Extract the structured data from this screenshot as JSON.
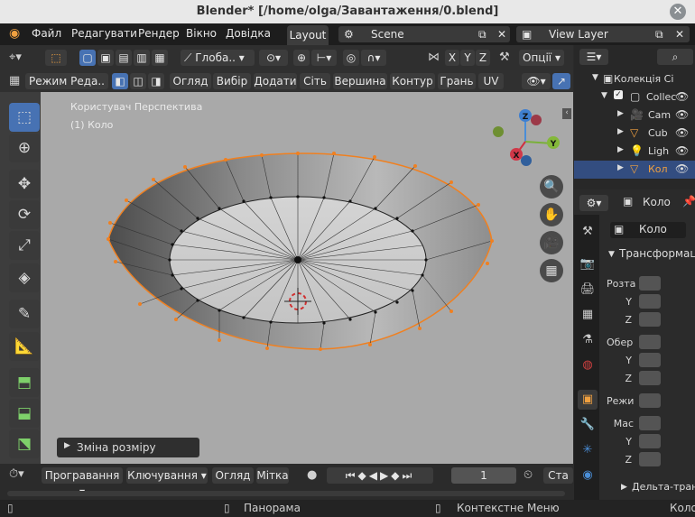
{
  "window": {
    "title": "Blender* [/home/olga/Завантаження/0.blend]"
  },
  "menu": {
    "items": [
      "Файл",
      "Редагувати",
      "Рендер",
      "Вікно",
      "Довідка"
    ],
    "active_workspace": "Layout"
  },
  "scene": {
    "name": "Scene",
    "view_layer": "View Layer"
  },
  "header": {
    "transform_orientation": "Глоба..",
    "options_label": "Опції",
    "axes": [
      "X",
      "Y",
      "Z"
    ],
    "mode": "Режим Реда..",
    "menus": [
      "Огляд",
      "Вибір",
      "Додати",
      "Сіть",
      "Вершина",
      "Контур",
      "Грань",
      "UV"
    ]
  },
  "viewport": {
    "view_name": "Користувач Перспектива",
    "object_name": "(1) Коло",
    "last_op_panel": "Зміна розміру",
    "gizmo_axes": [
      "X",
      "Y",
      "Z"
    ]
  },
  "timeline": {
    "playback": "Програвання",
    "keying": "Ключування",
    "view": "Огляд",
    "marker": "Мітка",
    "current_frame": "1",
    "start_label": "Ста"
  },
  "status": {
    "middle": "Панорама",
    "right": "Контекстне Меню",
    "far_right": "Коло"
  },
  "outliner": {
    "collection": "Колекція Сі",
    "items": [
      {
        "label": "Collec",
        "icon": "collection-icon"
      },
      {
        "label": "Cam",
        "icon": "camera-icon"
      },
      {
        "label": "Cub",
        "icon": "mesh-icon"
      },
      {
        "label": "Ligh",
        "icon": "light-icon"
      },
      {
        "label": "Кол",
        "icon": "mesh-icon",
        "selected": true
      }
    ]
  },
  "properties": {
    "header_object": "Коло",
    "object_name": "Коло",
    "section": "Трансформац",
    "location": "Розта",
    "rotation": "Обер",
    "mode": "Режи",
    "scale": "Мас",
    "y": "Y",
    "z": "Z",
    "delta": "Дельта-тран"
  }
}
